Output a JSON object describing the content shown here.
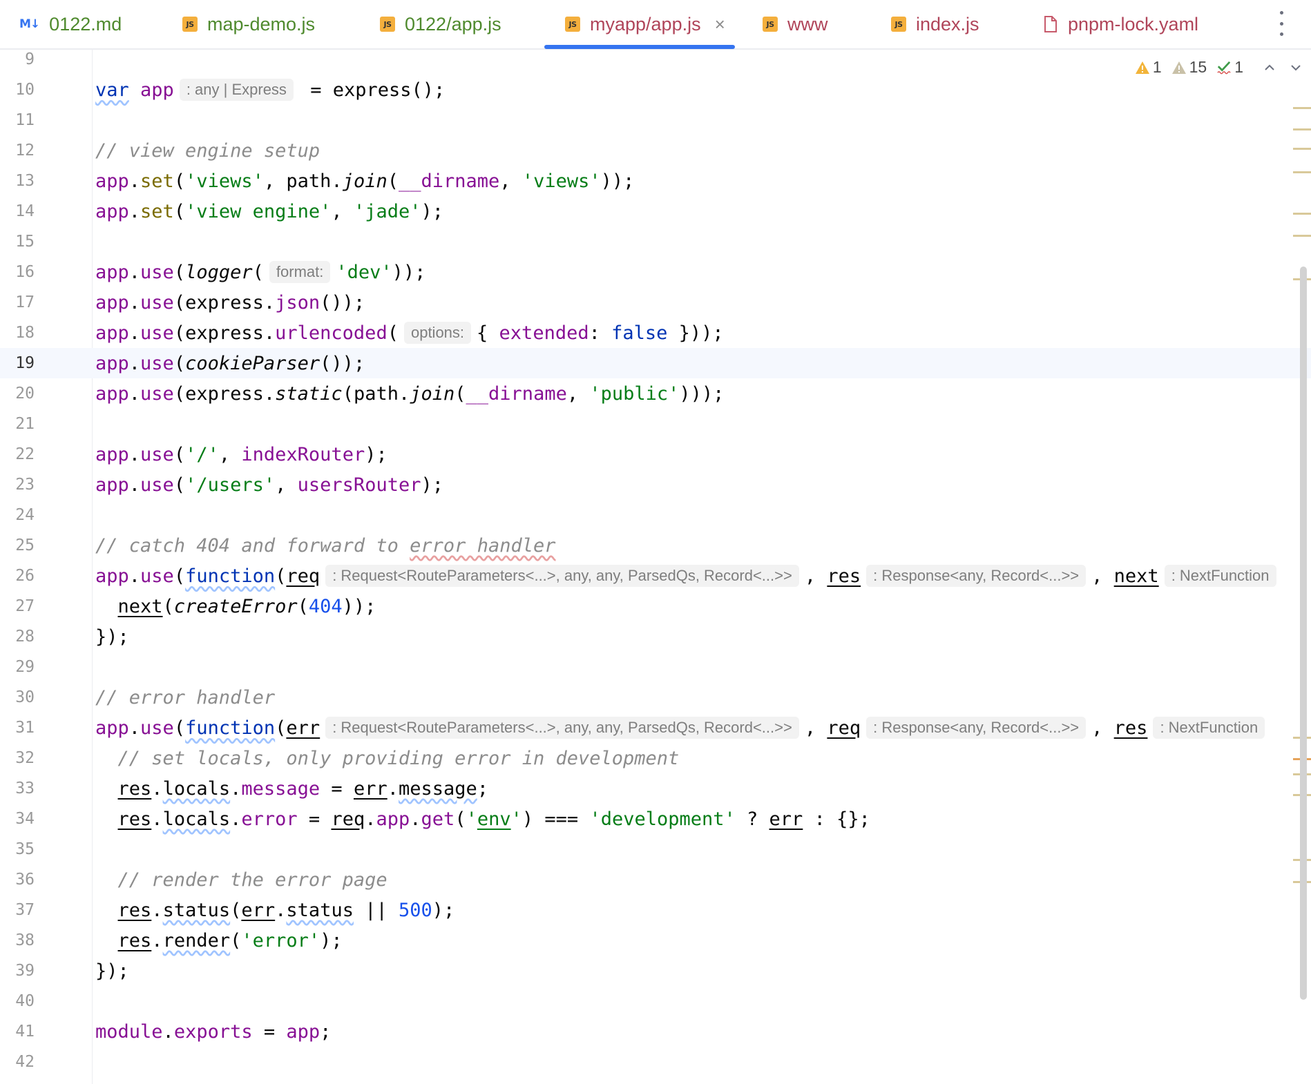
{
  "tabs": [
    {
      "label": "0122.md",
      "icon": "markdown-icon",
      "icon_text": "M↓"
    },
    {
      "label": "map-demo.js",
      "icon": "js-file-icon",
      "icon_text": "JS"
    },
    {
      "label": "0122/app.js",
      "icon": "js-file-icon",
      "icon_text": "JS"
    },
    {
      "label": "myapp/app.js",
      "icon": "js-file-icon",
      "icon_text": "JS",
      "active": true
    },
    {
      "label": "www",
      "icon": "js-file-icon",
      "icon_text": "JS"
    },
    {
      "label": "index.js",
      "icon": "js-file-icon",
      "icon_text": "JS"
    },
    {
      "label": "pnpm-lock.yaml",
      "icon": "yaml-file-icon"
    }
  ],
  "tab_close_glyph": "×",
  "inspections": {
    "warnings_strong": "1",
    "warnings_weak": "15",
    "typos": "1"
  },
  "lines": {
    "l9": "9",
    "l10": "10",
    "l11": "11",
    "l12": "12",
    "l13": "13",
    "l14": "14",
    "l15": "15",
    "l16": "16",
    "l17": "17",
    "l18": "18",
    "l19": "19",
    "l20": "20",
    "l21": "21",
    "l22": "22",
    "l23": "23",
    "l24": "24",
    "l25": "25",
    "l26": "26",
    "l27": "27",
    "l28": "28",
    "l29": "29",
    "l30": "30",
    "l31": "31",
    "l32": "32",
    "l33": "33",
    "l34": "34",
    "l35": "35",
    "l36": "36",
    "l37": "37",
    "l38": "38",
    "l39": "39",
    "l40": "40",
    "l41": "41",
    "l42": "42"
  },
  "code": {
    "l10": {
      "kw": "var",
      "name": "app",
      "hint": ": any | Express",
      "rest": " = express();"
    },
    "l12": "// view engine setup",
    "l13": {
      "a": "app",
      "b": ".",
      "c": "set",
      "d": "(",
      "e": "'views'",
      "f": ", path.",
      "g": "join",
      "h": "(",
      "i": "__dirname",
      "j": ", ",
      "k": "'views'",
      "l": "));"
    },
    "l14": {
      "a": "app",
      "b": ".",
      "c": "set",
      "d": "(",
      "e": "'view engine'",
      "f": ", ",
      "g": "'jade'",
      "h": ");"
    },
    "l16": {
      "a": "app",
      "b": ".",
      "c": "use",
      "d": "(",
      "e": "logger",
      "f": "(",
      "hint": "format:",
      "g": "'dev'",
      "h": "));"
    },
    "l17": {
      "a": "app",
      "b": ".",
      "c": "use",
      "d": "(express.",
      "e": "json",
      "f": "());"
    },
    "l18": {
      "a": "app",
      "b": ".",
      "c": "use",
      "d": "(express.",
      "e": "urlencoded",
      "f": "(",
      "hint": "options:",
      "g": "{ ",
      "h": "extended",
      "i": ": ",
      "j": "false",
      "k": " }));"
    },
    "l19": {
      "a": "app",
      "b": ".",
      "c": "use",
      "d": "(",
      "e": "cookieParser",
      "f": "());"
    },
    "l20": {
      "a": "app",
      "b": ".",
      "c": "use",
      "d": "(express.",
      "e": "static",
      "f": "(path.",
      "g": "join",
      "h": "(",
      "i": "__dirname",
      "j": ", ",
      "k": "'public'",
      "l": ")));"
    },
    "l22": {
      "a": "app",
      "b": ".",
      "c": "use",
      "d": "(",
      "e": "'/'",
      "f": ", ",
      "g": "indexRouter",
      "h": ");"
    },
    "l23": {
      "a": "app",
      "b": ".",
      "c": "use",
      "d": "(",
      "e": "'/users'",
      "f": ", ",
      "g": "usersRouter",
      "h": ");"
    },
    "l25": {
      "a": "// catch 404 and forward to ",
      "b": "error handler"
    },
    "l26": {
      "a": "app",
      "b": ".",
      "c": "use",
      "d": "(",
      "e": "function",
      "f": "(",
      "g": "req",
      "h1": ": Request<RouteParameters<...>, any, any, ParsedQs, Record<...>>",
      "i": ", ",
      "j": "res",
      "h2": ": Response<any, Record<...>>",
      "k": ", ",
      "l": "next",
      "h3": ": NextFunction"
    },
    "l27": {
      "a": "  ",
      "b": "next",
      "c": "(",
      "d": "createError",
      "e": "(",
      "f": "404",
      "g": "));"
    },
    "l28": "});",
    "l30": "// error handler",
    "l31": {
      "a": "app",
      "b": ".",
      "c": "use",
      "d": "(",
      "e": "function",
      "f": "(",
      "g": "err",
      "h1": ": Request<RouteParameters<...>, any, any, ParsedQs, Record<...>>",
      "i": ", ",
      "j": "req",
      "h2": ": Response<any, Record<...>>",
      "k": ", ",
      "l": "res",
      "h3": ": NextFunction"
    },
    "l32": "  // set locals, only providing error in development",
    "l33": {
      "a": "  ",
      "b": "res",
      "c": ".",
      "d": "locals",
      "e": ".",
      "f": "message",
      "g": " = ",
      "h": "err",
      "i": ".",
      "j": "message",
      "k": ";"
    },
    "l34": {
      "a": "  ",
      "b": "res",
      "c": ".",
      "d": "locals",
      "e": ".",
      "f": "error",
      "g": " = ",
      "h": "req",
      "i": ".",
      "j": "app",
      "k": ".",
      "l": "get",
      "m": "(",
      "n": "'",
      "o": "env",
      "p": "'",
      "q": ") === ",
      "r": "'development'",
      "s": " ? ",
      "t": "err",
      "u": " : {};"
    },
    "l36": "  // render the error page",
    "l37": {
      "a": "  ",
      "b": "res",
      "c": ".",
      "d": "status",
      "e": "(",
      "f": "err",
      "g": ".",
      "h": "status",
      "i": " || ",
      "j": "500",
      "k": ");"
    },
    "l38": {
      "a": "  ",
      "b": "res",
      "c": ".",
      "d": "render",
      "e": "(",
      "f": "'error'",
      "g": ");"
    },
    "l39": "});",
    "l41": {
      "a": "module",
      "b": ".",
      "c": "exports",
      "d": " = ",
      "e": "app",
      "f": ";"
    }
  },
  "colors": {
    "accent": "#3574f0",
    "keyword": "#0033b3",
    "property": "#871094",
    "string": "#067d17",
    "number": "#1750eb",
    "comment": "#8c8c8c"
  }
}
